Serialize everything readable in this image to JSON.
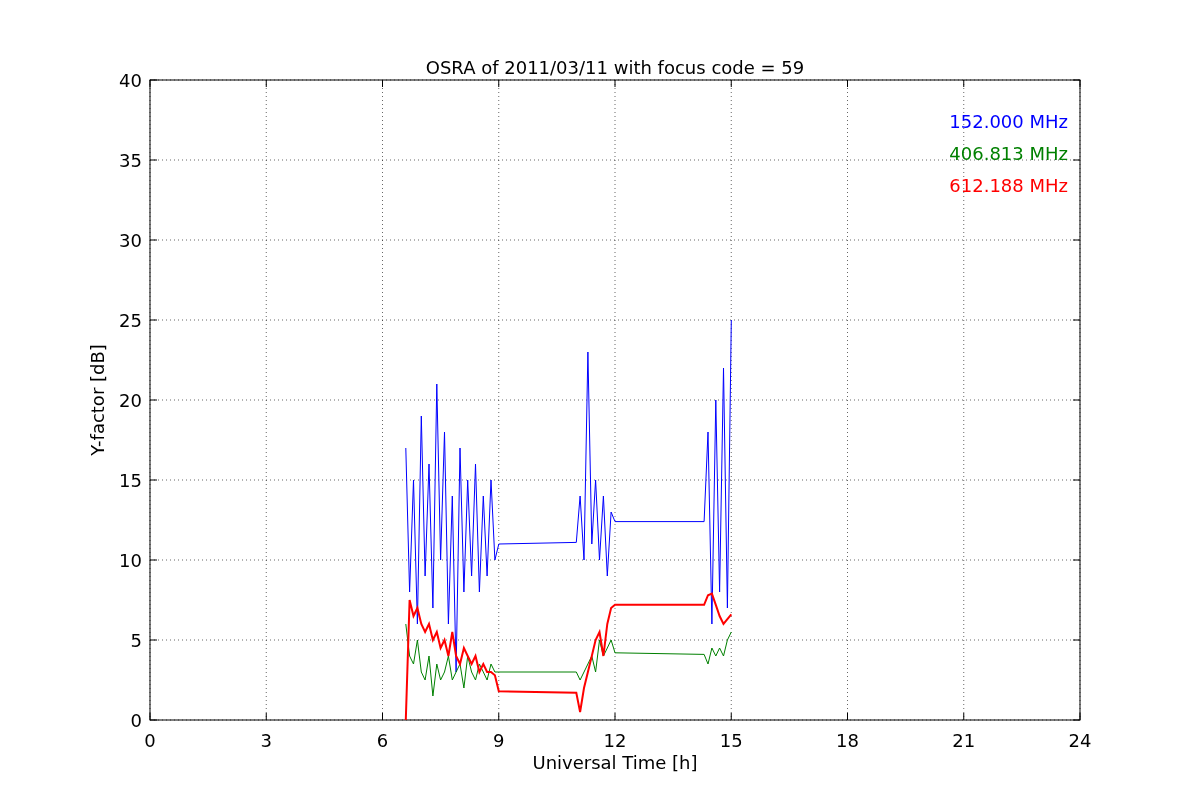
{
  "chart_data": {
    "type": "line",
    "title": "OSRA of 2011/03/11 with focus code = 59",
    "xlabel": "Universal Time [h]",
    "ylabel": "Y-factor [dB]",
    "xlim": [
      0,
      24
    ],
    "ylim": [
      0,
      40
    ],
    "grid": true,
    "xticks": [
      0,
      3,
      6,
      9,
      12,
      15,
      18,
      21,
      24
    ],
    "yticks": [
      0,
      5,
      10,
      15,
      20,
      25,
      30,
      35,
      40
    ],
    "x": [
      6.6,
      6.7,
      6.8,
      6.9,
      7.0,
      7.1,
      7.2,
      7.3,
      7.4,
      7.5,
      7.6,
      7.7,
      7.8,
      7.9,
      8.0,
      8.1,
      8.2,
      8.3,
      8.4,
      8.5,
      8.6,
      8.7,
      8.8,
      8.9,
      9.0,
      11.0,
      11.1,
      11.2,
      11.3,
      11.4,
      11.5,
      11.6,
      11.7,
      11.8,
      11.9,
      12.0,
      14.3,
      14.4,
      14.5,
      14.6,
      14.7,
      14.8,
      14.9,
      15.0
    ],
    "series": [
      {
        "name": "152.000 MHz",
        "color": "#0000ff",
        "values": [
          17,
          8,
          15,
          6,
          19,
          9,
          16,
          7,
          21,
          10,
          18,
          6,
          14,
          3,
          17,
          8,
          15,
          9,
          16,
          8,
          14,
          9,
          15,
          10,
          11,
          11.1,
          14,
          10,
          23,
          11,
          15,
          10,
          14,
          9,
          13,
          12.4,
          12.4,
          18,
          6,
          20,
          8,
          22,
          7,
          25
        ]
      },
      {
        "name": "406.813 MHz",
        "color": "#008000",
        "values": [
          6,
          4,
          3.5,
          5,
          3,
          2.5,
          4,
          1.5,
          3.5,
          2.5,
          3,
          4,
          2.5,
          3,
          3.5,
          2,
          4,
          3,
          2.5,
          3.5,
          3,
          2.5,
          3.5,
          3,
          3.0,
          3.0,
          2.5,
          3,
          3.5,
          4,
          3,
          5,
          4,
          4.5,
          5,
          4.2,
          4.1,
          3.5,
          4.5,
          4,
          4.5,
          4,
          5,
          5.5
        ]
      },
      {
        "name": "612.188 MHz",
        "color": "#ff0000",
        "values": [
          0,
          7.5,
          6.5,
          7,
          6,
          5.5,
          6,
          5,
          5.5,
          4.5,
          5,
          4,
          5.5,
          4,
          3.5,
          4.5,
          4,
          3.5,
          4,
          3,
          3.5,
          3,
          3,
          2.8,
          1.8,
          1.7,
          0.5,
          2,
          3,
          4,
          5,
          5.5,
          4,
          6,
          7,
          7.2,
          7.2,
          7.8,
          7.9,
          7.2,
          6.5,
          6,
          6.3,
          6.6
        ]
      }
    ]
  }
}
